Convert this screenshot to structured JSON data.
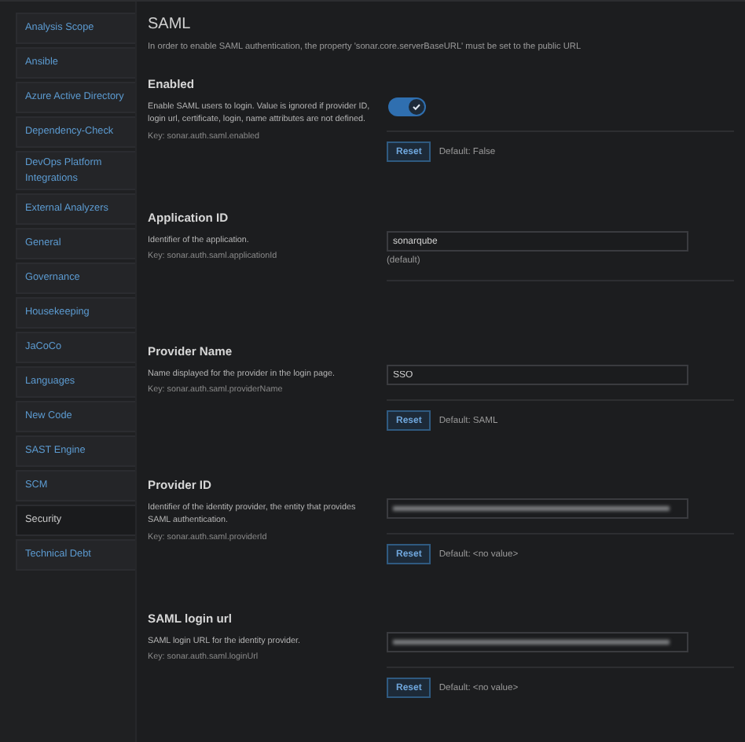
{
  "sidebar": {
    "items": [
      {
        "label": "Analysis Scope",
        "selected": false
      },
      {
        "label": "Ansible",
        "selected": false
      },
      {
        "label": "Azure Active Directory",
        "selected": false
      },
      {
        "label": "Dependency-Check",
        "selected": false
      },
      {
        "label": "DevOps Platform Integrations",
        "selected": false
      },
      {
        "label": "External Analyzers",
        "selected": false
      },
      {
        "label": "General",
        "selected": false
      },
      {
        "label": "Governance",
        "selected": false
      },
      {
        "label": "Housekeeping",
        "selected": false
      },
      {
        "label": "JaCoCo",
        "selected": false
      },
      {
        "label": "Languages",
        "selected": false
      },
      {
        "label": "New Code",
        "selected": false
      },
      {
        "label": "SAST Engine",
        "selected": false
      },
      {
        "label": "SCM",
        "selected": false
      },
      {
        "label": "Security",
        "selected": true
      },
      {
        "label": "Technical Debt",
        "selected": false
      }
    ]
  },
  "page": {
    "title": "SAML",
    "intro": "In order to enable SAML authentication, the property 'sonar.core.serverBaseURL' must be set to the public URL"
  },
  "settings": [
    {
      "kind": "toggle",
      "name": "Enabled",
      "description": "Enable SAML users to login. Value is ignored if provider ID, login url, certificate, login, name attributes are not defined.",
      "key": "Key: sonar.auth.saml.enabled",
      "on": true,
      "reset": "Reset",
      "default": "Default: False"
    },
    {
      "kind": "text",
      "name": "Application ID",
      "description": "Identifier of the application.",
      "key": "Key: sonar.auth.saml.applicationId",
      "value": "sonarqube",
      "note": "(default)"
    },
    {
      "kind": "text",
      "name": "Provider Name",
      "description": "Name displayed for the provider in the login page.",
      "key": "Key: sonar.auth.saml.providerName",
      "value": "SSO",
      "reset": "Reset",
      "default": "Default: SAML"
    },
    {
      "kind": "redacted",
      "name": "Provider ID",
      "description": "Identifier of the identity provider, the entity that provides SAML authentication.",
      "key": "Key: sonar.auth.saml.providerId",
      "reset": "Reset",
      "default": "Default: <no value>"
    },
    {
      "kind": "redacted",
      "name": "SAML login url",
      "description": "SAML login URL for the identity provider.",
      "key": "Key: sonar.auth.saml.loginUrl",
      "reset": "Reset",
      "default": "Default: <no value>"
    }
  ]
}
